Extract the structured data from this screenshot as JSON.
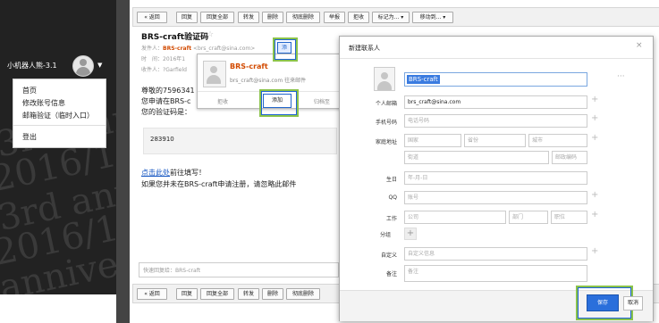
{
  "sidebar": {
    "user_name": "小机器人熊-3.1",
    "menu": [
      "首页",
      "修改账号信息",
      "邮箱验证（临时入口）",
      "登出"
    ],
    "watermark": [
      "3rd anniv",
      "2016/10/",
      "3rd annive",
      "2016/10/1",
      "anniversa"
    ]
  },
  "toolbar": {
    "buttons": [
      "« 返回",
      "回复",
      "回复全部",
      "转发",
      "删除",
      "彻底删除",
      "举报",
      "拒收",
      "标记为... ▾",
      "移动到... ▾"
    ]
  },
  "mail": {
    "subject": "BRS-craft验证码",
    "star": "☆",
    "sender_label": "发件人：",
    "sender_name": "BRS-craft",
    "sender_email": "<brs_craft@sina.com>",
    "time_label": "时　间：",
    "time_value": "2016年1",
    "to_label": "收件人：",
    "to_value": "?Garfield",
    "body_lines": [
      "尊敬的7596341",
      "您申请在BRS-c",
      "您的验证码是："
    ],
    "code": "283910",
    "link_text": "点击此处",
    "link_suffix": "前往填写！",
    "note": "如果您并未在BRS-craft申请注册，请忽略此邮件",
    "quick_reply_placeholder": "快速回复给：BRS-craft"
  },
  "popup": {
    "name": "BRS-craft",
    "email": "brs_craft@sina.com  往来邮件",
    "reject": "拒收",
    "add": "添加",
    "more": "归档至",
    "tag": "添"
  },
  "dialog": {
    "title": "新建联系人",
    "close": "×",
    "name_value": "BRS-craft",
    "dots": "···",
    "fields": {
      "email_label": "个人邮箱",
      "email_value": "brs_craft@sina.com",
      "phone_label": "手机号码",
      "phone_placeholder": "电话号码",
      "address_label": "家庭地址",
      "country": "国家",
      "province": "省份",
      "city": "城市",
      "street": "街道",
      "zip": "邮政编码",
      "birthday_label": "生日",
      "birthday_placeholder": "年-月-日",
      "qq_label": "QQ",
      "qq_placeholder": "账号",
      "work_label": "工作",
      "company": "公司",
      "dept": "部门",
      "position": "职位",
      "group_label": "分组",
      "custom_label": "自定义",
      "custom_placeholder": "自定义信息",
      "note_label": "备注",
      "note_placeholder": "备注"
    },
    "save": "保存",
    "cancel": "取消"
  }
}
